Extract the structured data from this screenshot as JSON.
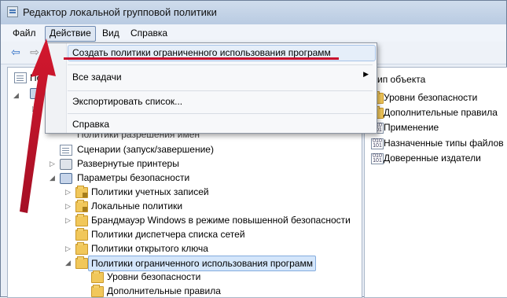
{
  "window": {
    "title": "Редактор локальной групповой политики"
  },
  "menubar": {
    "items": [
      "Файл",
      "Действие",
      "Вид",
      "Справка"
    ]
  },
  "dropdown": {
    "items": [
      "Создать политики ограниченного использования программ",
      "Все задачи",
      "Экспортировать список...",
      "Справка"
    ]
  },
  "tree": {
    "root_partial": "По",
    "obscured_row": "Политики разрешения имен",
    "items": [
      {
        "label": "Сценарии (запуск/завершение)"
      },
      {
        "label": "Развернутые принтеры"
      },
      {
        "label": "Параметры безопасности"
      },
      {
        "label": "Политики учетных записей"
      },
      {
        "label": "Локальные политики"
      },
      {
        "label": "Брандмауэр Windows в режиме повышенной безопасности"
      },
      {
        "label": "Политики диспетчера списка сетей"
      },
      {
        "label": "Политики открытого ключа"
      },
      {
        "label": "Политики ограниченного использования программ"
      },
      {
        "label": "Уровни безопасности"
      },
      {
        "label": "Дополнительные правила"
      }
    ]
  },
  "right_pane": {
    "header_partial": "ип объекта",
    "items": [
      "Уровни безопасности",
      "Дополнительные правила",
      "Применение",
      "Назначенные типы файлов",
      "Доверенные издатели"
    ]
  },
  "annotation_color": "#c8102e"
}
